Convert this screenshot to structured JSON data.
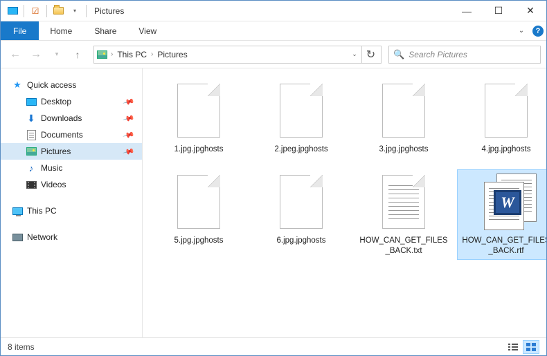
{
  "window": {
    "title": "Pictures",
    "minimize": "—",
    "maximize": "☐",
    "close": "✕"
  },
  "ribbon": {
    "file": "File",
    "tabs": [
      "Home",
      "Share",
      "View"
    ]
  },
  "address": {
    "crumbs": [
      "This PC",
      "Pictures"
    ],
    "search_placeholder": "Search Pictures"
  },
  "navpane": {
    "quick_access": "Quick access",
    "items": [
      {
        "label": "Desktop",
        "icon": "desktop",
        "pinned": true
      },
      {
        "label": "Downloads",
        "icon": "download",
        "pinned": true
      },
      {
        "label": "Documents",
        "icon": "doc",
        "pinned": true
      },
      {
        "label": "Pictures",
        "icon": "pic",
        "pinned": true,
        "selected": true
      },
      {
        "label": "Music",
        "icon": "music",
        "pinned": false
      },
      {
        "label": "Videos",
        "icon": "video",
        "pinned": false
      }
    ],
    "this_pc": "This PC",
    "network": "Network"
  },
  "files": [
    {
      "name": "1.jpg.jpghosts",
      "type": "blank"
    },
    {
      "name": "2.jpeg.jpghosts",
      "type": "blank"
    },
    {
      "name": "3.jpg.jpghosts",
      "type": "blank"
    },
    {
      "name": "4.jpg.jpghosts",
      "type": "blank"
    },
    {
      "name": "5.jpg.jpghosts",
      "type": "blank"
    },
    {
      "name": "6.jpg.jpghosts",
      "type": "blank"
    },
    {
      "name": "HOW_CAN_GET_FILES_BACK.txt",
      "type": "txt"
    },
    {
      "name": "HOW_CAN_GET_FILES_BACK.rtf",
      "type": "rtf",
      "selected": true
    }
  ],
  "status": {
    "count_label": "8 items"
  }
}
